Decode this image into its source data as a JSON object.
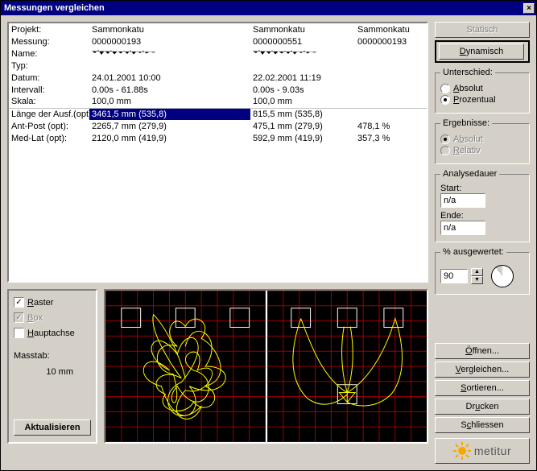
{
  "window": {
    "title": "Messungen vergleichen"
  },
  "table": {
    "labels": {
      "projekt": "Projekt:",
      "messung": "Messung:",
      "name": "Name:",
      "typ": "Typ:",
      "datum": "Datum:",
      "intervall": "Intervall:",
      "skala": "Skala:",
      "laenge": "Länge der Ausf.(opt):",
      "antpost": "Ant-Post (opt):",
      "medlat": "Med-Lat (opt):"
    },
    "cols": [
      {
        "projekt": "Sammonkatu",
        "messung": "0000000193",
        "datum": "24.01.2001  10:00",
        "intervall": "0.00s - 61.88s",
        "skala": "100,0 mm",
        "laenge": "3461,5 mm (535,8)",
        "antpost": "2265,7 mm (279,9)",
        "medlat": "2120,0 mm (419,9)"
      },
      {
        "projekt": "Sammonkatu",
        "messung": "0000000551",
        "datum": "22.02.2001  11:19",
        "intervall": "0.00s - 9.03s",
        "skala": "100,0 mm",
        "laenge": "815,5 mm (535,8)",
        "antpost": "475,1 mm (279,9)",
        "medlat": "592,9 mm (419,9)"
      },
      {
        "projekt": "Sammonkatu",
        "messung": "0000000193",
        "antpost_diff": "478,1 %",
        "medlat_diff": "357,3 %"
      }
    ]
  },
  "options": {
    "raster": "Raster",
    "box": "Box",
    "hauptachse": "Hauptachse",
    "massstab_label": "Masstab:",
    "massstab_value": "10 mm",
    "aktualisieren": "Aktualisieren"
  },
  "right": {
    "statisch": "Statisch",
    "dynamisch": "Dynamisch",
    "unterschied": {
      "title": "Unterschied:",
      "absolut": "Absolut",
      "prozentual": "Prozentual"
    },
    "ergebnisse": {
      "title": "Ergebnisse:",
      "absolut": "Absolut",
      "relativ": "Relativ"
    },
    "analysedauer": {
      "title": "Analysedauer",
      "start": "Start:",
      "ende": "Ende:",
      "na": "n/a"
    },
    "ausgewertet": {
      "label": "% ausgewertet:",
      "value": "90"
    },
    "buttons": {
      "oeffnen": "Öffnen...",
      "vergleichen": "Vergleichen...",
      "sortieren": "Sortieren...",
      "drucken": "Drucken",
      "schliessen": "Schliessen"
    },
    "logo": "metitur"
  }
}
